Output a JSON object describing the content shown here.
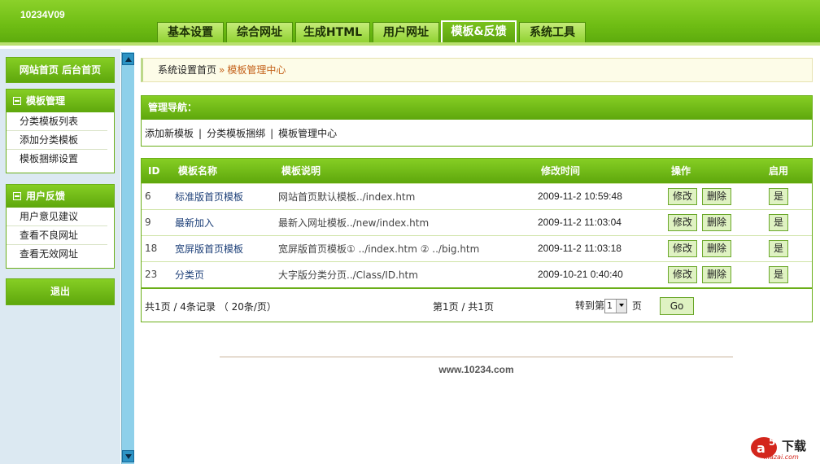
{
  "header": {
    "brand": "10234V09",
    "tabs": [
      "基本设置",
      "综合网址",
      "生成HTML",
      "用户网址",
      "模板&反馈",
      "系统工具"
    ],
    "active_tab": "模板&反馈"
  },
  "sidebar": {
    "home_links": "网站首页  后台首页",
    "template_group": {
      "title": "模板管理",
      "items": [
        "分类模板列表",
        "添加分类模板",
        "模板捆绑设置"
      ]
    },
    "feedback_group": {
      "title": "用户反馈",
      "items": [
        "用户意见建议",
        "查看不良网址",
        "查看无效网址"
      ]
    },
    "logout": "退出"
  },
  "breadcrumb": {
    "root": "系统设置首页",
    "separator": "»",
    "current": "模板管理中心"
  },
  "nav_panel": {
    "title": "管理导航：",
    "links": [
      "添加新模板",
      "分类模板捆绑",
      "模板管理中心"
    ]
  },
  "table": {
    "columns": [
      "ID",
      "模板名称",
      "模板说明",
      "修改时间",
      "操作",
      "启用"
    ],
    "rows": [
      {
        "id": "6",
        "name": "标准版首页模板",
        "desc": "网站首页默认模板../index.htm",
        "time": "2009-11-2 10:59:48"
      },
      {
        "id": "9",
        "name": "最新加入",
        "desc": "最新入网址模板../new/index.htm",
        "time": "2009-11-2 11:03:04"
      },
      {
        "id": "18",
        "name": "宽屏版首页模板",
        "desc": "宽屏版首页模板① ../index.htm ② ../big.htm",
        "time": "2009-11-2 11:03:18"
      },
      {
        "id": "23",
        "name": "分类页",
        "desc": "大字版分类分页../Class/ID.htm",
        "time": "2009-10-21 0:40:40"
      }
    ],
    "edit_label": "修改",
    "delete_label": "删除",
    "enable_label": "是"
  },
  "pager": {
    "summary": "共1页  / 4条记录 （ 20条/页）",
    "position": "第1页  / 共1页",
    "goto_prefix": "转到第",
    "page_value": "1",
    "goto_suffix": "页",
    "go_label": "Go"
  },
  "footer": {
    "site": "www.10234.com"
  },
  "watermark": {
    "text": "下载",
    "sub": "xiazai.com"
  },
  "colors": {
    "brand_green": "#6fbd14",
    "breadcrumb_accent": "#c4611a",
    "link_blue": "#1c3f78"
  }
}
